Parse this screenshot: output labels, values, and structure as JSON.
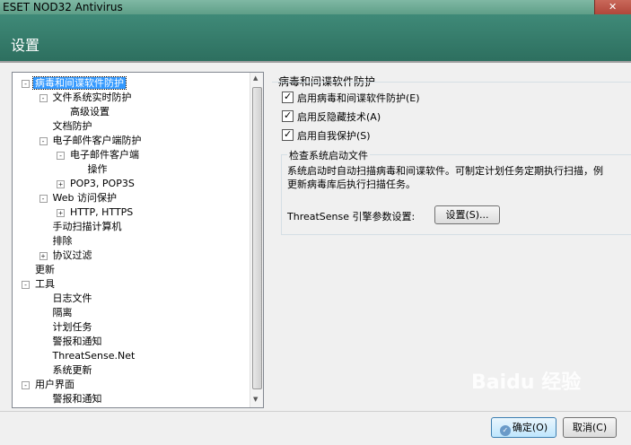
{
  "window": {
    "title": "ESET NOD32 Antivirus"
  },
  "header": {
    "title": "设置"
  },
  "tree": {
    "items": [
      {
        "label": "病毒和间谍软件防护",
        "expander": "-",
        "selected": true
      },
      {
        "label": "文件系统实时防护",
        "expander": "-"
      },
      {
        "label": "高级设置",
        "expander": ""
      },
      {
        "label": "文档防护",
        "expander": ""
      },
      {
        "label": "电子邮件客户端防护",
        "expander": "-"
      },
      {
        "label": "电子邮件客户端",
        "expander": "-"
      },
      {
        "label": "操作",
        "expander": ""
      },
      {
        "label": "POP3, POP3S",
        "expander": "+"
      },
      {
        "label": "Web 访问保护",
        "expander": "-"
      },
      {
        "label": "HTTP, HTTPS",
        "expander": "+"
      },
      {
        "label": "手动扫描计算机",
        "expander": ""
      },
      {
        "label": "排除",
        "expander": ""
      },
      {
        "label": "协议过滤",
        "expander": "+"
      },
      {
        "label": "更新",
        "expander": ""
      },
      {
        "label": "工具",
        "expander": "-"
      },
      {
        "label": "日志文件",
        "expander": ""
      },
      {
        "label": "隔离",
        "expander": ""
      },
      {
        "label": "计划任务",
        "expander": ""
      },
      {
        "label": "警报和通知",
        "expander": ""
      },
      {
        "label": "ThreatSense.Net",
        "expander": ""
      },
      {
        "label": "系统更新",
        "expander": ""
      },
      {
        "label": "用户界面",
        "expander": "-"
      },
      {
        "label": "警报和通知",
        "expander": ""
      }
    ]
  },
  "panel": {
    "group_title": "病毒和间谍软件防护",
    "checkboxes": [
      {
        "label": "启用病毒和间谍软件防护(E)",
        "checked": true
      },
      {
        "label": "启用反隐藏技术(A)",
        "checked": true
      },
      {
        "label": "启用自我保护(S)",
        "checked": true
      }
    ],
    "startup": {
      "title": "检查系统启动文件",
      "text_line1": "系统启动时自动扫描病毒和间谍软件。可制定计划任务定期执行扫描，例",
      "text_line2": "更新病毒库后执行扫描任务。",
      "threatsense_label": "ThreatSense 引擎参数设置:",
      "settings_button": "设置(S)..."
    }
  },
  "footer": {
    "ok_button": "确定(O)",
    "cancel_button": "取消(C)"
  },
  "watermark": "Baidu 经验"
}
